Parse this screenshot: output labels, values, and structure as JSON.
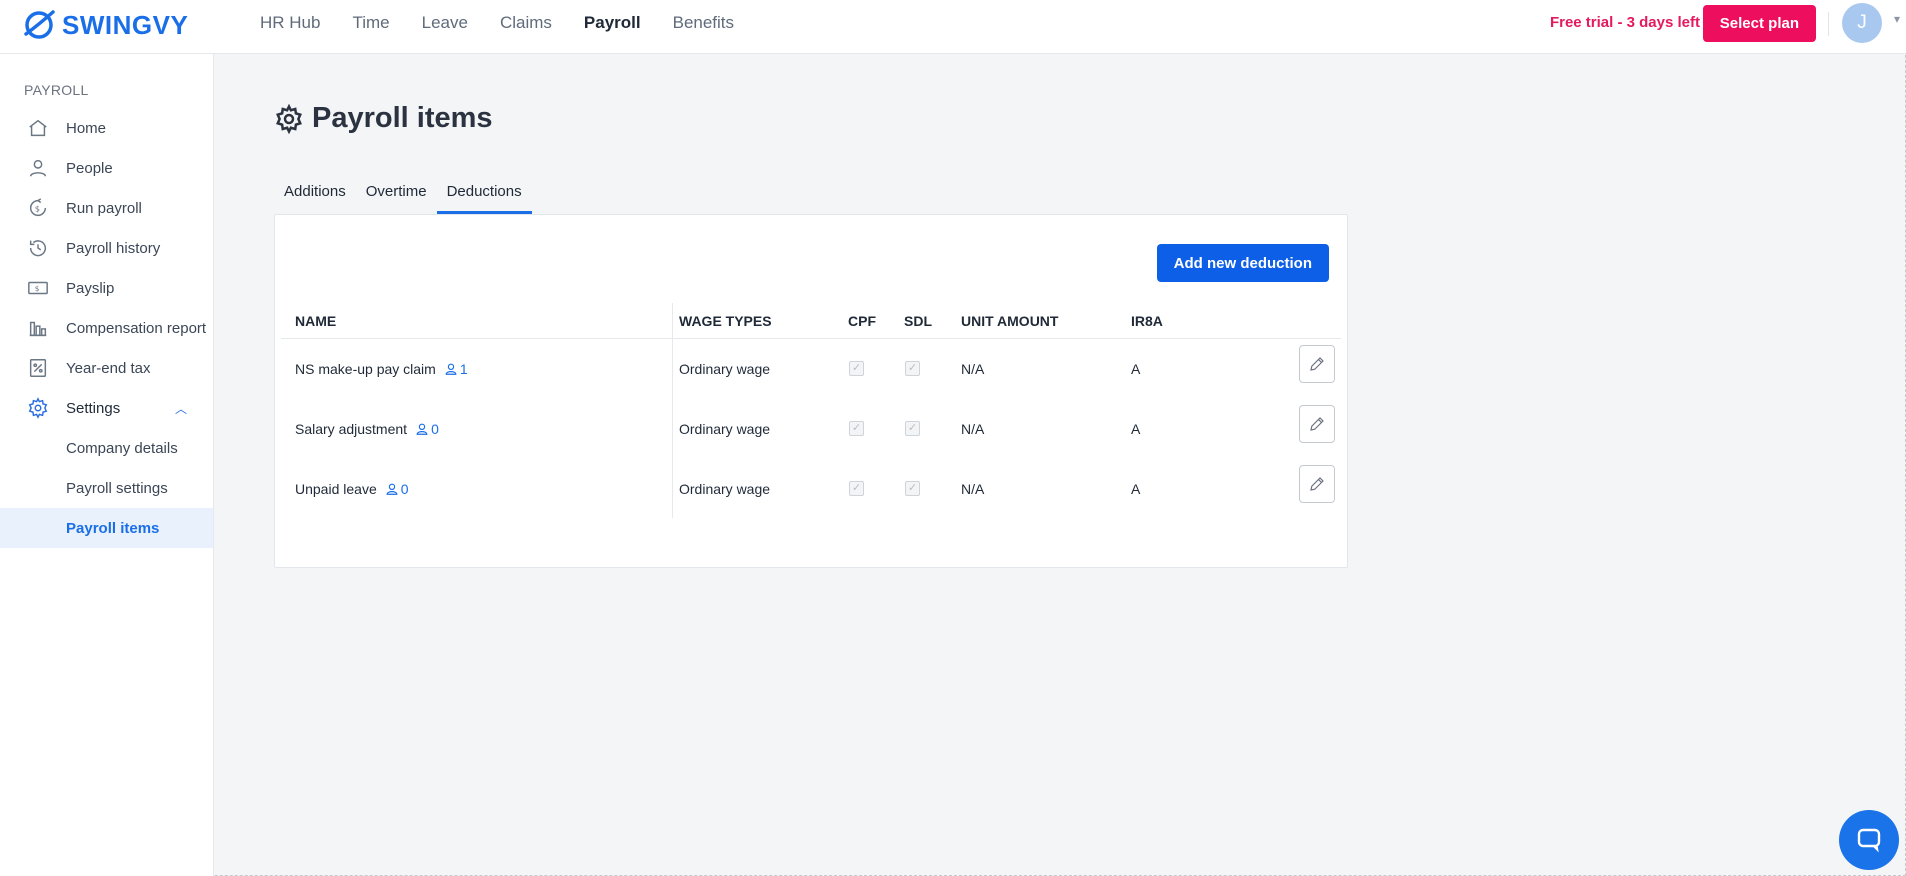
{
  "brand": {
    "name": "SWINGVY"
  },
  "nav": {
    "items": [
      {
        "label": "HR Hub",
        "active": false
      },
      {
        "label": "Time",
        "active": false
      },
      {
        "label": "Leave",
        "active": false
      },
      {
        "label": "Claims",
        "active": false
      },
      {
        "label": "Payroll",
        "active": true
      },
      {
        "label": "Benefits",
        "active": false
      }
    ]
  },
  "header": {
    "trial_text": "Free trial - 3 days left",
    "select_plan_label": "Select plan",
    "avatar_initial": "J"
  },
  "sidebar": {
    "heading": "PAYROLL",
    "items": [
      {
        "label": "Home",
        "icon": "home-icon"
      },
      {
        "label": "People",
        "icon": "person-icon"
      },
      {
        "label": "Run payroll",
        "icon": "dollar-clock-icon"
      },
      {
        "label": "Payroll history",
        "icon": "history-icon"
      },
      {
        "label": "Payslip",
        "icon": "payslip-icon"
      },
      {
        "label": "Compensation report",
        "icon": "bar-chart-icon"
      },
      {
        "label": "Year-end tax",
        "icon": "percent-doc-icon"
      },
      {
        "label": "Settings",
        "icon": "gear-icon"
      },
      {
        "label": "Company details"
      },
      {
        "label": "Payroll settings"
      },
      {
        "label": "Payroll items",
        "active": true
      }
    ]
  },
  "page": {
    "title": "Payroll items",
    "tabs": [
      {
        "label": "Additions",
        "active": false
      },
      {
        "label": "Overtime",
        "active": false
      },
      {
        "label": "Deductions",
        "active": true
      }
    ],
    "add_button_label": "Add new deduction",
    "columns": {
      "name": "NAME",
      "wage_types": "WAGE TYPES",
      "cpf": "CPF",
      "sdl": "SDL",
      "unit_amount": "UNIT AMOUNT",
      "ir8a": "IR8A"
    },
    "rows": [
      {
        "name": "NS make-up pay claim",
        "count": "1",
        "wage_type": "Ordinary wage",
        "cpf": true,
        "sdl": true,
        "unit_amount": "N/A",
        "ir8a": "A"
      },
      {
        "name": "Salary adjustment",
        "count": "0",
        "wage_type": "Ordinary wage",
        "cpf": true,
        "sdl": true,
        "unit_amount": "N/A",
        "ir8a": "A"
      },
      {
        "name": "Unpaid leave",
        "count": "0",
        "wage_type": "Ordinary wage",
        "cpf": true,
        "sdl": true,
        "unit_amount": "N/A",
        "ir8a": "A"
      }
    ]
  },
  "colors": {
    "brand_blue": "#1a6fe8",
    "primary_button": "#0d5fe8",
    "trial_pink": "#e5195f",
    "select_plan_bg": "#ed0f5e",
    "active_sidebar_bg": "#e9f1fd"
  }
}
